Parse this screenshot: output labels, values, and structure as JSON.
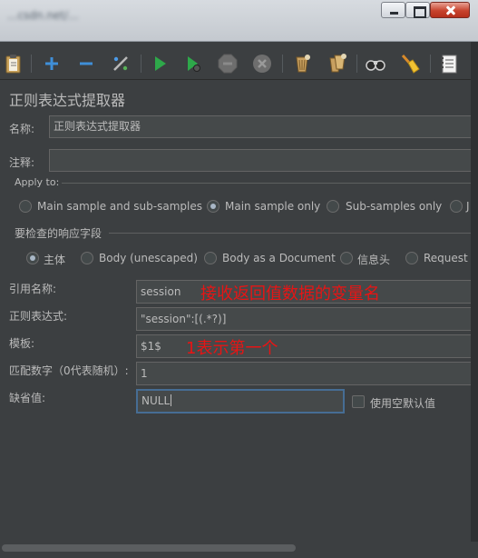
{
  "window": {
    "title": "...csdn.net/...",
    "controls": {
      "minimize": "minimize",
      "maximize": "maximize",
      "close": "close"
    }
  },
  "toolbar": {
    "icons": [
      "clipboard-icon",
      "add-icon",
      "remove-icon",
      "toggle-wand-icon",
      "start-icon",
      "start-no-pauses-icon",
      "stop-icon",
      "shutdown-icon",
      "clear-icon",
      "clear-all-icon",
      "search-binoculars-icon",
      "reset-search-broom-icon",
      "function-helper-icon"
    ]
  },
  "panel": {
    "title": "正则表达式提取器",
    "name_label": "名称:",
    "name_value": "正则表达式提取器",
    "comments_label": "注释:",
    "comments_value": "",
    "apply_to": {
      "legend": "Apply to:",
      "options": [
        "Main sample and sub-samples",
        "Main sample only",
        "Sub-samples only",
        "J"
      ],
      "selected": "Main sample only"
    },
    "field_to_check": {
      "legend": "要检查的响应字段",
      "options": [
        "主体",
        "Body (unescaped)",
        "Body as a Document",
        "信息头",
        "Request I"
      ],
      "selected": "主体"
    },
    "reference_name": {
      "label": "引用名称:",
      "value": "session",
      "annotation": "接收返回值数据的变量名"
    },
    "regex": {
      "label": "正则表达式:",
      "value": "\"session\":[(.*?)]"
    },
    "template": {
      "label": "模板:",
      "value": "$1$",
      "annotation": "1表示第一个"
    },
    "match_no": {
      "label": "匹配数字（0代表随机）:",
      "value": "1"
    },
    "default_value": {
      "label": "缺省值:",
      "value": "NULL"
    },
    "use_empty_default": {
      "label": "使用空默认值",
      "checked": false
    }
  },
  "colors": {
    "background": "#3c3f41",
    "field_background": "#45494a",
    "text": "#bbbbbb",
    "annotation": "#e81414",
    "focus_border": "#466d94"
  }
}
